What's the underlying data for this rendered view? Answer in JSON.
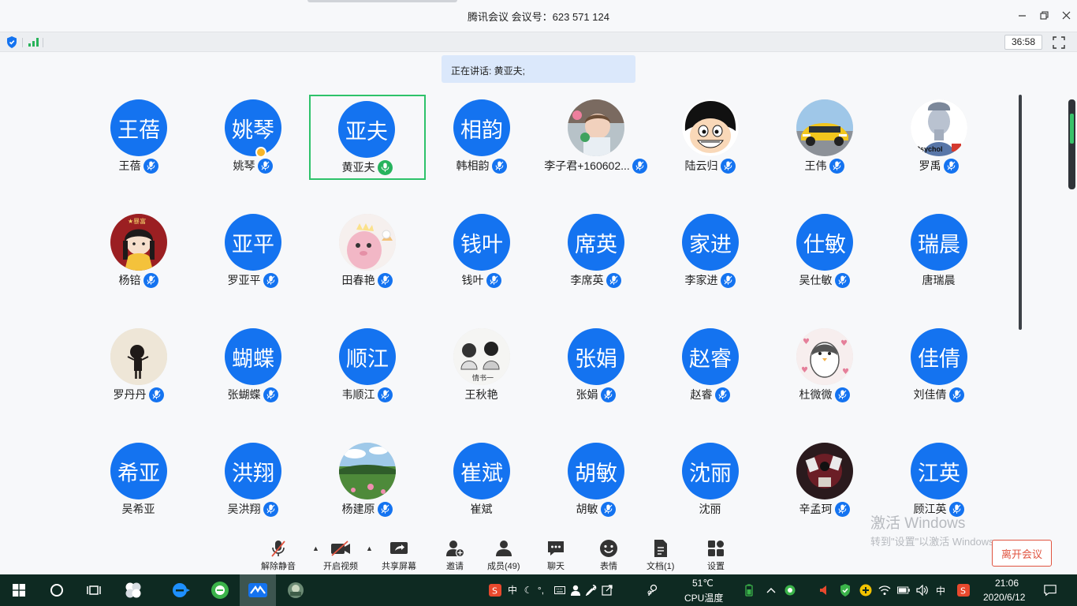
{
  "window": {
    "title": "腾讯会议 会议号：623 571 124",
    "controls": [
      "minimize",
      "restore",
      "close"
    ]
  },
  "statusbar": {
    "timer": "36:58"
  },
  "speaking": {
    "text": "正在讲话: 黄亚夫;"
  },
  "participants": [
    {
      "avatar": "王蓓",
      "name": "王蓓",
      "mic": "muted"
    },
    {
      "avatar": "姚琴",
      "name": "姚琴",
      "mic": "muted",
      "host": true
    },
    {
      "avatar": "亚夫",
      "name": "黄亚夫",
      "mic": "speaking",
      "active": true
    },
    {
      "avatar": "相韵",
      "name": "韩相韵",
      "mic": "muted"
    },
    {
      "photo": "boy",
      "name": "李子君+160602...",
      "mic": "muted"
    },
    {
      "photo": "cartoon-boy",
      "name": "陆云归",
      "mic": "muted"
    },
    {
      "photo": "yellow-car",
      "name": "王伟",
      "mic": "muted"
    },
    {
      "photo": "statue",
      "name": "罗禹",
      "mic": "muted"
    },
    {
      "photo": "girl-red",
      "name": "杨锫",
      "mic": "muted"
    },
    {
      "avatar": "亚平",
      "name": "罗亚平",
      "mic": "muted"
    },
    {
      "photo": "pink-dino",
      "name": "田春艳",
      "mic": "muted"
    },
    {
      "avatar": "钱叶",
      "name": "钱叶",
      "mic": "muted"
    },
    {
      "avatar": "席英",
      "name": "李席英",
      "mic": "muted"
    },
    {
      "avatar": "家进",
      "name": "李家进",
      "mic": "muted"
    },
    {
      "avatar": "仕敏",
      "name": "吴仕敏",
      "mic": "muted"
    },
    {
      "avatar": "瑞晨",
      "name": "唐瑞晨",
      "mic": "none"
    },
    {
      "photo": "girl-beige",
      "name": "罗丹丹",
      "mic": "muted"
    },
    {
      "avatar": "蝴蝶",
      "name": "张蝴蝶",
      "mic": "muted"
    },
    {
      "avatar": "顺江",
      "name": "韦顺江",
      "mic": "muted"
    },
    {
      "photo": "sketch",
      "name": "王秋艳",
      "mic": "none"
    },
    {
      "avatar": "张娟",
      "name": "张娟",
      "mic": "muted"
    },
    {
      "avatar": "赵睿",
      "name": "赵睿",
      "mic": "muted"
    },
    {
      "photo": "penguin",
      "name": "杜微微",
      "mic": "muted"
    },
    {
      "avatar": "佳倩",
      "name": "刘佳倩",
      "mic": "muted"
    },
    {
      "avatar": "希亚",
      "name": "吴希亚",
      "mic": "none"
    },
    {
      "avatar": "洪翔",
      "name": "吴洪翔",
      "mic": "muted"
    },
    {
      "photo": "landscape",
      "name": "杨建原",
      "mic": "muted"
    },
    {
      "avatar": "崔斌",
      "name": "崔斌",
      "mic": "none"
    },
    {
      "avatar": "胡敏",
      "name": "胡敏",
      "mic": "muted"
    },
    {
      "avatar": "沈丽",
      "name": "沈丽",
      "mic": "none"
    },
    {
      "photo": "dark-red",
      "name": "辛孟珂",
      "mic": "muted"
    },
    {
      "avatar": "江英",
      "name": "顾江英",
      "mic": "muted"
    }
  ],
  "toolbar": {
    "unmute": "解除静音",
    "video": "开启视频",
    "share": "共享屏幕",
    "invite": "邀请",
    "members": "成员(49)",
    "chat": "聊天",
    "emoji": "表情",
    "docs": "文档(1)",
    "settings": "设置",
    "leave": "离开会议"
  },
  "watermark": {
    "line1": "激活 Windows",
    "line2": "转到\"设置\"以激活 Windows。"
  },
  "taskbar": {
    "ime1": "中",
    "ime2": "中",
    "temp": "51℃",
    "cpu": "CPU温度",
    "time": "21:06",
    "date": "2020/6/12"
  },
  "colors": {
    "accent": "#1473f0",
    "speaking": "#26b35d",
    "leave": "#e0533f",
    "taskbar": "#0e2a22"
  }
}
